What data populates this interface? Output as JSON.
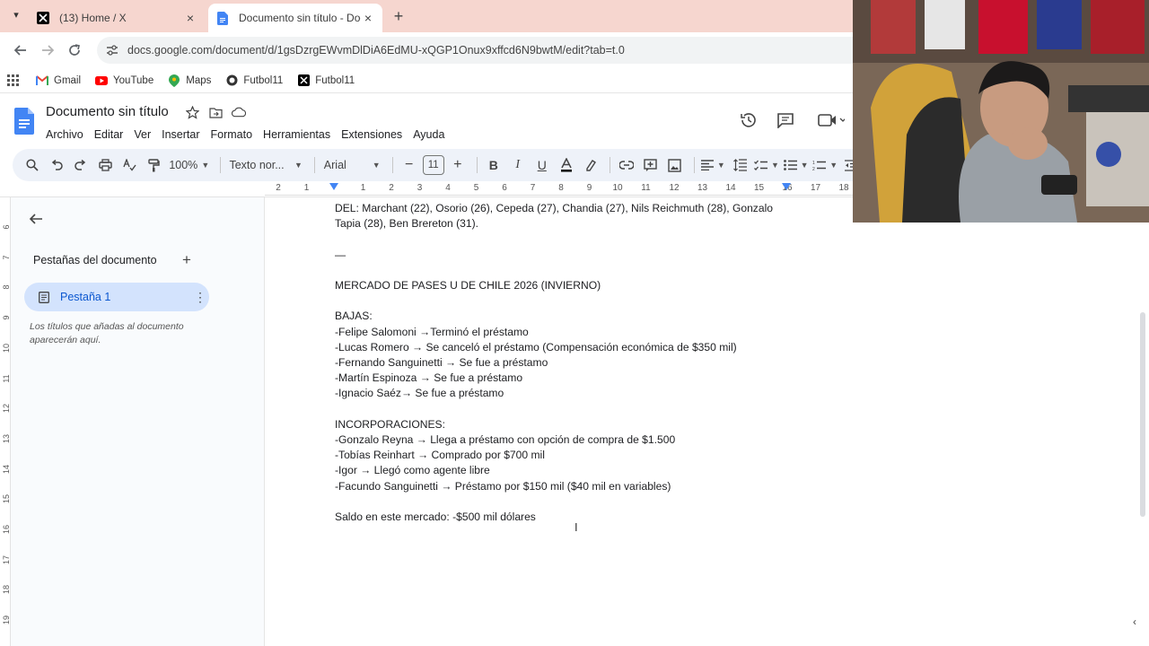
{
  "browser": {
    "tabs": [
      {
        "title": "(13) Home / X",
        "icon": "x-logo-icon",
        "active": false
      },
      {
        "title": "Documento sin título - Docume",
        "icon": "google-docs-icon",
        "active": true
      }
    ],
    "url": "docs.google.com/document/d/1gsDzrgEWvmDlDiA6EdMU-xQGP1Onux9xffcd6N9bwtM/edit?tab=t.0",
    "bookmarks": [
      {
        "label": "Gmail",
        "icon": "gmail-icon"
      },
      {
        "label": "YouTube",
        "icon": "youtube-icon"
      },
      {
        "label": "Maps",
        "icon": "maps-icon"
      },
      {
        "label": "Futbol11",
        "icon": "globe-icon"
      },
      {
        "label": "Futbol11",
        "icon": "x-logo-icon"
      }
    ]
  },
  "docs": {
    "title": "Documento sin título",
    "menu": [
      "Archivo",
      "Editar",
      "Ver",
      "Insertar",
      "Formato",
      "Herramientas",
      "Extensiones",
      "Ayuda"
    ],
    "toolbar": {
      "zoom": "100%",
      "style": "Texto nor...",
      "font": "Arial",
      "font_size": "11"
    },
    "ruler_ticks": [
      "2",
      "1",
      "1",
      "2",
      "3",
      "4",
      "5",
      "6",
      "7",
      "8",
      "9",
      "10",
      "11",
      "12",
      "13",
      "14",
      "15",
      "16",
      "17",
      "18"
    ],
    "vruler_ticks": [
      "6",
      "7",
      "8",
      "9",
      "10",
      "11",
      "12",
      "13",
      "14",
      "15",
      "16",
      "17",
      "18",
      "19"
    ],
    "sidebar": {
      "heading": "Pestañas del documento",
      "tab_label": "Pestaña 1",
      "hint": "Los títulos que añadas al documento aparecerán aquí."
    },
    "content": [
      "DEL: Marchant (22), Osorio (26), Cepeda (27), Chandia (27), Nils Reichmuth (28), Gonzalo Tapia (28), Ben Brereton (31).",
      "",
      "—",
      "",
      "MERCADO DE PASES U DE CHILE 2026 (INVIERNO)",
      "",
      "BAJAS:",
      "-Felipe Salomoni →Terminó el préstamo",
      "-Lucas Romero → Se canceló el préstamo (Compensación económica de $350 mil)",
      "-Fernando Sanguinetti → Se fue a préstamo",
      "-Martín Espinoza → Se fue a préstamo",
      "-Ignacio Saéz→ Se fue a préstamo",
      "",
      "INCORPORACIONES:",
      "-Gonzalo Reyna → Llega a préstamo con opción de compra de $1.500",
      "-Tobías Reinhart → Comprado por $700 mil",
      "-Igor → Llegó como agente libre",
      "-Facundo Sanguinetti → Préstamo por $150 mil ($40 mil en variables)",
      "",
      "Saldo en este mercado: -$500 mil dólares"
    ]
  }
}
